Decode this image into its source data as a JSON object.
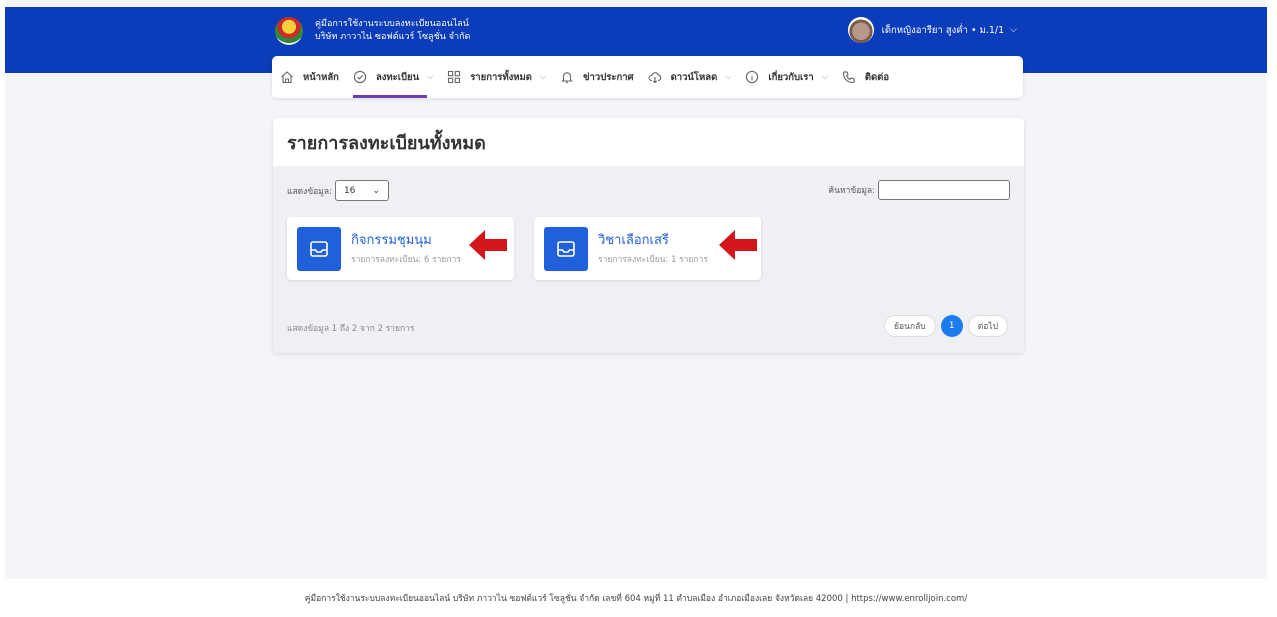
{
  "header": {
    "brand_line1": "คู่มือการใช้งานระบบลงทะเบียนออนไลน์",
    "brand_line2": "บริษัท ภาวาไน่ ซอฟต์แวร์ โซลูชั่น จำกัด",
    "user_name": "เด็กหญิงอารียา สูงค่ำ • ม.1/1"
  },
  "nav": [
    {
      "label": "หน้าหลัก",
      "icon": "home-icon"
    },
    {
      "label": "ลงทะเบียน",
      "icon": "check-circle-icon",
      "active": true,
      "has_dropdown": true
    },
    {
      "label": "รายการทั้งหมด",
      "icon": "grid-icon",
      "has_dropdown": true
    },
    {
      "label": "ข่าวประกาศ",
      "icon": "bell-icon"
    },
    {
      "label": "ดาวน์โหลด",
      "icon": "cloud-download-icon",
      "has_dropdown": true
    },
    {
      "label": "เกี่ยวกับเรา",
      "icon": "info-icon",
      "has_dropdown": true
    },
    {
      "label": "ติดต่อ",
      "icon": "phone-icon"
    }
  ],
  "main": {
    "title": "รายการลงทะเบียนทั้งหมด",
    "show_label": "แสดงข้อมูล:",
    "page_size": "16",
    "search_label": "ค้นหาข้อมูล:",
    "search_placeholder": "",
    "items": [
      {
        "title": "กิจกรรมชุมนุม",
        "subtitle": "รายการลงทะเบียน: 6 รายการ"
      },
      {
        "title": "วิชาเลือกเสรี",
        "subtitle": "รายการลงทะเบียน: 1 รายการ"
      }
    ],
    "info": "แสดงข้อมูล 1 ถึง 2 จาก 2 รายการ",
    "pagination": {
      "prev": "ย้อนกลับ",
      "current": "1",
      "next": "ต่อไป"
    }
  },
  "footer": {
    "text": "คู่มือการใช้งานระบบลงทะเบียนออนไลน์ บริษัท ภาวาไน่ ซอฟต์แวร์ โซลูชั่น จำกัด เลขที่ 604 หมู่ที่ 11 ตำบลเมือง อำเภอเมืองเลย จังหวัดเลย 42000 | https://www.enrolljoin.com/"
  },
  "colors": {
    "header_bg": "#0b3cba",
    "accent": "#2060d8",
    "annotation_arrow": "#d3161c",
    "active_tab": "#6a3fb5"
  }
}
